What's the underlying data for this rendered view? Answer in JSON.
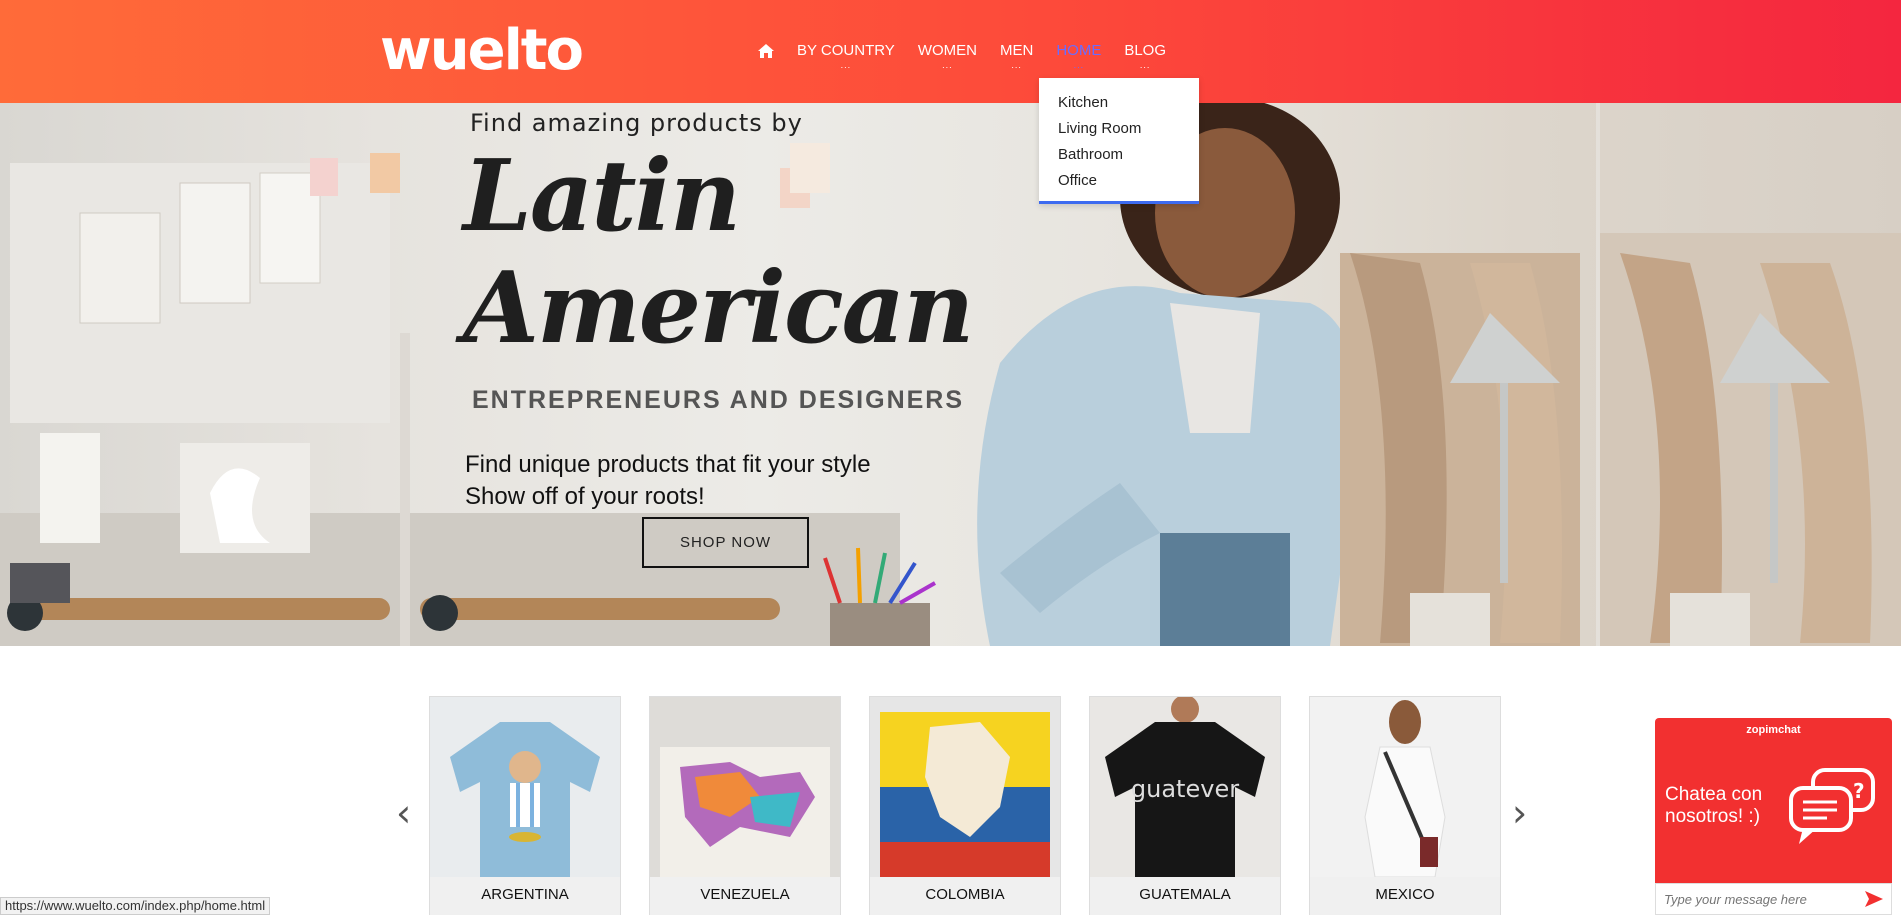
{
  "brand": {
    "logo_text": "wuelto"
  },
  "nav": {
    "items": [
      {
        "label": "BY COUNTRY"
      },
      {
        "label": "WOMEN"
      },
      {
        "label": "MEN"
      },
      {
        "label": "HOME"
      },
      {
        "label": "BLOG"
      }
    ],
    "dots": "...",
    "active": "HOME",
    "active_color": "#6a6cff"
  },
  "dropdown": {
    "items": [
      "Kitchen",
      "Living Room",
      "Bathroom",
      "Office"
    ]
  },
  "hero": {
    "kicker": "Find amazing products by",
    "title_line1": "Latin",
    "title_line2": "American",
    "subtitle": "ENTREPRENEURS AND DESIGNERS",
    "desc_line1": "Find unique products that fit your style",
    "desc_line2": "Show off of your roots!",
    "cta": "SHOP NOW"
  },
  "carousel": {
    "cards": [
      {
        "label": "ARGENTINA"
      },
      {
        "label": "VENEZUELA"
      },
      {
        "label": "COLOMBIA"
      },
      {
        "label": "GUATEMALA"
      },
      {
        "label": "MEXICO"
      }
    ],
    "prev_icon": "chevron-left-icon",
    "next_icon": "chevron-right-icon"
  },
  "chat": {
    "brand": "zopimchat",
    "message": "Chatea con nosotros! :)",
    "placeholder": "Type your message here"
  },
  "status_bar": {
    "url": "https://www.wuelto.com/index.php/home.html"
  },
  "colors": {
    "header_start": "#ff6b39",
    "header_end": "#f4263f",
    "chat_bg": "#f23030",
    "dropdown_accent": "#3d6bf0"
  }
}
